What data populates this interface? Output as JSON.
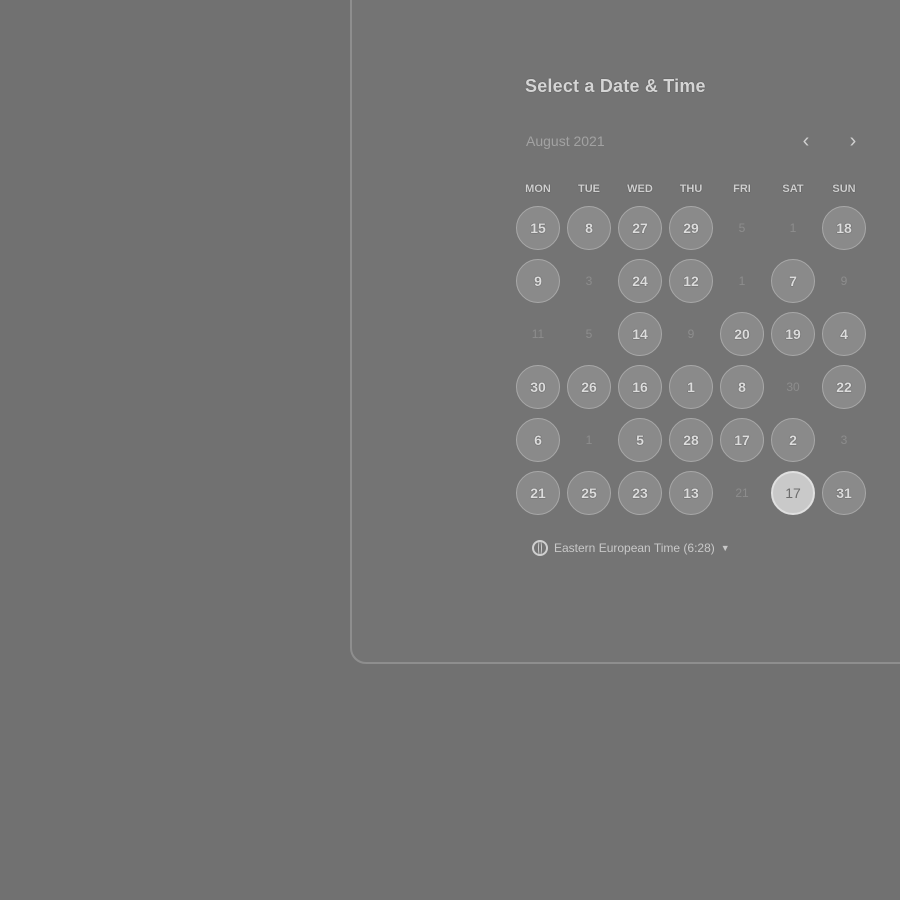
{
  "booking": {
    "title": "Select a Date & Time",
    "month_label": "August 2021",
    "prev_icon": "chevron-left-icon",
    "next_icon": "chevron-right-icon",
    "weekdays": [
      "MON",
      "TUE",
      "WED",
      "THU",
      "FRI",
      "SAT",
      "SUN"
    ],
    "rows": [
      [
        {
          "label": "15",
          "state": "available"
        },
        {
          "label": "8",
          "state": "available"
        },
        {
          "label": "27",
          "state": "available"
        },
        {
          "label": "29",
          "state": "available"
        },
        {
          "label": "5",
          "state": "unavailable"
        },
        {
          "label": "1",
          "state": "unavailable"
        },
        {
          "label": "18",
          "state": "available"
        }
      ],
      [
        {
          "label": "9",
          "state": "available"
        },
        {
          "label": "3",
          "state": "unavailable"
        },
        {
          "label": "24",
          "state": "available"
        },
        {
          "label": "12",
          "state": "available"
        },
        {
          "label": "1",
          "state": "unavailable"
        },
        {
          "label": "7",
          "state": "available"
        },
        {
          "label": "9",
          "state": "unavailable"
        }
      ],
      [
        {
          "label": "11",
          "state": "unavailable"
        },
        {
          "label": "5",
          "state": "unavailable"
        },
        {
          "label": "14",
          "state": "available"
        },
        {
          "label": "9",
          "state": "unavailable"
        },
        {
          "label": "20",
          "state": "available"
        },
        {
          "label": "19",
          "state": "available"
        },
        {
          "label": "4",
          "state": "available"
        }
      ],
      [
        {
          "label": "30",
          "state": "available"
        },
        {
          "label": "26",
          "state": "available"
        },
        {
          "label": "16",
          "state": "available"
        },
        {
          "label": "1",
          "state": "available"
        },
        {
          "label": "8",
          "state": "available"
        },
        {
          "label": "30",
          "state": "unavailable"
        },
        {
          "label": "22",
          "state": "available"
        }
      ],
      [
        {
          "label": "6",
          "state": "available"
        },
        {
          "label": "1",
          "state": "unavailable"
        },
        {
          "label": "5",
          "state": "available"
        },
        {
          "label": "28",
          "state": "available"
        },
        {
          "label": "17",
          "state": "available"
        },
        {
          "label": "2",
          "state": "available"
        },
        {
          "label": "3",
          "state": "unavailable"
        }
      ],
      [
        {
          "label": "21",
          "state": "available"
        },
        {
          "label": "25",
          "state": "available"
        },
        {
          "label": "23",
          "state": "available"
        },
        {
          "label": "13",
          "state": "available"
        },
        {
          "label": "21",
          "state": "unavailable"
        },
        {
          "label": "17",
          "state": "selected"
        },
        {
          "label": "31",
          "state": "available"
        }
      ]
    ],
    "timezone": {
      "icon": "globe-icon",
      "label": "Eastern European Time (6:28)"
    }
  }
}
